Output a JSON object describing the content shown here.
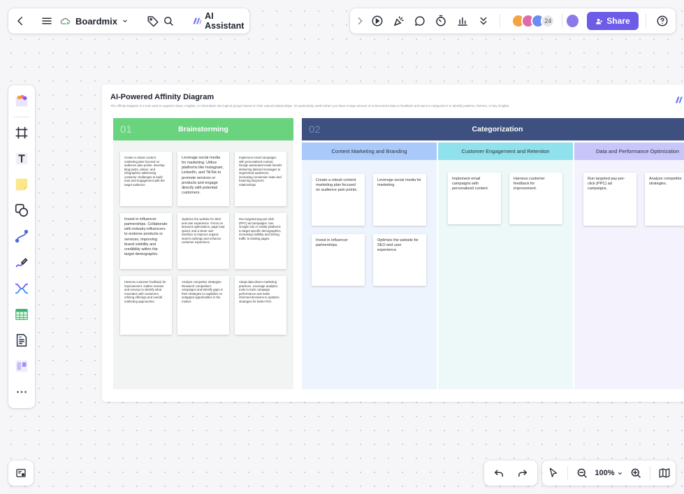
{
  "topbar": {
    "brand": "Boardmix",
    "ai_label": "AI Assistant",
    "avatar_count": "24",
    "share_label": "Share",
    "avatar_colors": [
      "#f4a340",
      "#e06aa8",
      "#6b8df0"
    ]
  },
  "board": {
    "title": "AI-Powered Affinity Diagram",
    "description": "The Affinity Diagram is a tool used to organize ideas, insights, or information into logical groups based on their natural relationships. It's particularly useful when you have a large amount of unstructured data or feedback and want to categorize it to identify patterns, themes, or key insights.",
    "brainstorm": {
      "number": "01",
      "title": "Brainstorming",
      "notes": [
        "Create a robust content marketing plan focused on audience pain points. Develop blog posts, videos, and infographics addressing customer challenges to build trust and engagement with the target audience.",
        "Leverage social media for marketing. Utilize platforms like Instagram, LinkedIn, and TikTok to promote services or products and engage directly with potential customers.",
        "Implement email campaigns with personalized content. Design automated email funnels delivering tailored messages to segmented audiences, increasing conversion rates and fostering long-term relationships.",
        "Invest in influencer partnerships. Collaborate with industry influencers to endorse products or services, improving brand visibility and credibility within the target demographic.",
        "Optimize the website for SEO and user experience. Focus on keyword optimization, page load speed, and a clean user interface to improve organic search rankings and enhance customer experience.",
        "Run targeted pay-per-click (PPC) ad campaigns. Use Google Ads or similar platforms to target specific demographics, increasing visibility and driving traffic to landing pages.",
        "Harness customer feedback for improvement. Gather reviews and surveys to identify what resonates with customers, refining offerings and overall marketing approaches.",
        "Analyze competitor strategies. Research competitors' campaigns and identify gaps in their strategies to capitalize on untapped opportunities in the market.",
        "Adopt data-driven marketing practices. Leverage analytics tools to track campaign performance and make informed decisions to optimize strategies for better ROI."
      ]
    },
    "categorization": {
      "number": "02",
      "title": "Categorization",
      "groups": [
        {
          "title": "Content Marketing and Branding",
          "notes": [
            "Create a robust content marketing plan focused on audience pain points.",
            "Leverage social media for marketing.",
            "Invest in influencer partnerships.",
            "Optimize the website for SEO and user experience."
          ]
        },
        {
          "title": "Customer Engagement and Retention",
          "notes": [
            "Implement email campaigns with personalized content.",
            "Harness customer feedback for improvement."
          ]
        },
        {
          "title": "Data and Performance Optimization",
          "notes": [
            "Run targeted pay-per-click (PPC) ad campaigns.",
            "Analyze competitor strategies."
          ]
        }
      ]
    }
  },
  "zoom": {
    "level": "100%"
  },
  "colors": {
    "brainstorm": "#69d37e",
    "categorization": "#3d5080",
    "group1_head": "#a9c9fb",
    "group2_head": "#8fe2ec",
    "group3_head": "#c8c5fa",
    "share": "#6c5ce7"
  },
  "icons": {
    "top_left": [
      "back-arrow-icon",
      "menu-icon",
      "cloud-sync-icon",
      "chevron-down-icon",
      "tag-icon",
      "search-icon",
      "ai-logo-icon"
    ],
    "top_right": [
      "chevron-right-icon",
      "play-icon",
      "celebrate-icon",
      "comment-icon",
      "timer-icon",
      "chart-icon",
      "double-chevron-down-icon",
      "share-user-icon",
      "help-icon"
    ],
    "left_toolbar": [
      "templates-icon",
      "frame-icon",
      "text-icon",
      "sticky-note-icon",
      "shapes-icon",
      "connector-icon",
      "pen-icon",
      "mind-map-icon",
      "table-icon",
      "document-icon",
      "kanban-icon",
      "more-icon"
    ],
    "bottom": [
      "layers-icon",
      "undo-icon",
      "redo-icon",
      "pointer-icon",
      "zoom-out-icon",
      "zoom-in-icon",
      "map-icon"
    ]
  }
}
